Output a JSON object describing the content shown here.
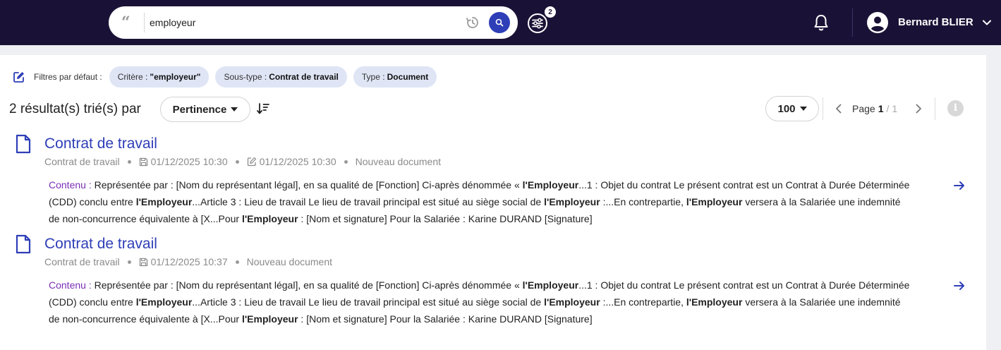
{
  "search": {
    "value": "employeur",
    "filter_count": "2"
  },
  "user": {
    "name": "Bernard BLIER"
  },
  "filters": {
    "label": "Filtres par défaut :",
    "chips": [
      {
        "key": "Critère :",
        "value": "\"employeur\""
      },
      {
        "key": "Sous-type :",
        "value": "Contrat de travail"
      },
      {
        "key": "Type :",
        "value": "Document"
      }
    ]
  },
  "results_header": {
    "count_text": "2 résultat(s) trié(s) par",
    "sort_by": "Pertinence",
    "per_page": "100",
    "page_label": "Page",
    "page_current": "1",
    "page_sep": "/",
    "page_total": "1",
    "info_glyph": "i"
  },
  "results": [
    {
      "title": "Contrat de travail",
      "subtype": "Contrat de travail",
      "created": "01/12/2025 10:30",
      "modified": "01/12/2025 10:30",
      "status": "Nouveau document",
      "content_label": "Contenu :",
      "snippet": [
        {
          "t": " Représentée par : [Nom du représentant légal], en sa qualité de [Fonction] Ci-après dénommée « ",
          "b": false
        },
        {
          "t": "l'Employeur",
          "b": true
        },
        {
          "t": "...1 : Objet du contrat Le présent contrat est un Contrat à Durée Déterminée (CDD) conclu entre ",
          "b": false
        },
        {
          "t": "l'Employeur",
          "b": true
        },
        {
          "t": "...Article 3 : Lieu de travail Le lieu de travail principal est situé au siège social de ",
          "b": false
        },
        {
          "t": "l'Employeur",
          "b": true
        },
        {
          "t": " :...En contrepartie, ",
          "b": false
        },
        {
          "t": "l'Employeur",
          "b": true
        },
        {
          "t": " versera à la Salariée une indemnité de non-concurrence équivalente à [X...Pour ",
          "b": false
        },
        {
          "t": "l'Employeur",
          "b": true
        },
        {
          "t": " : [Nom et signature] Pour la Salariée : Karine DURAND [Signature]",
          "b": false
        }
      ]
    },
    {
      "title": "Contrat de travail",
      "subtype": "Contrat de travail",
      "created": "01/12/2025 10:37",
      "modified": "",
      "status": "Nouveau document",
      "content_label": "Contenu :",
      "snippet": [
        {
          "t": " Représentée par : [Nom du représentant légal], en sa qualité de [Fonction] Ci-après dénommée « ",
          "b": false
        },
        {
          "t": "l'Employeur",
          "b": true
        },
        {
          "t": "...1 : Objet du contrat Le présent contrat est un Contrat à Durée Déterminée (CDD) conclu entre ",
          "b": false
        },
        {
          "t": "l'Employeur",
          "b": true
        },
        {
          "t": "...Article 3 : Lieu de travail Le lieu de travail principal est situé au siège social de ",
          "b": false
        },
        {
          "t": "l'Employeur",
          "b": true
        },
        {
          "t": " :...En contrepartie, ",
          "b": false
        },
        {
          "t": "l'Employeur",
          "b": true
        },
        {
          "t": " versera à la Salariée une indemnité de non-concurrence équivalente à [X...Pour ",
          "b": false
        },
        {
          "t": "l'Employeur",
          "b": true
        },
        {
          "t": " : [Nom et signature] Pour la Salariée : Karine DURAND [Signature]",
          "b": false
        }
      ]
    }
  ],
  "icons": {
    "quote": "quote-icon",
    "history": "history-icon",
    "search": "search-icon",
    "filter": "sliders-icon",
    "bell": "bell-icon",
    "avatar": "user-icon",
    "document": "document-icon",
    "arrow": "arrow-right-icon"
  },
  "colors": {
    "topbar": "#1a1236",
    "accent": "#2e3eb7",
    "chip": "#dfe5f5",
    "content_label": "#7a2fb8"
  }
}
